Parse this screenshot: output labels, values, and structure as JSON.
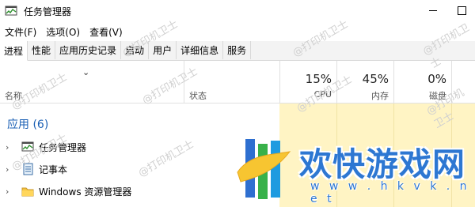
{
  "window": {
    "title": "任务管理器"
  },
  "menu": {
    "file": "文件(F)",
    "options": "选项(O)",
    "view": "查看(V)"
  },
  "tabs": [
    {
      "label": "进程",
      "active": true
    },
    {
      "label": "性能"
    },
    {
      "label": "应用历史记录"
    },
    {
      "label": "启动"
    },
    {
      "label": "用户"
    },
    {
      "label": "详细信息"
    },
    {
      "label": "服务"
    }
  ],
  "columns": {
    "name": "名称",
    "status": "状态",
    "cpu": {
      "pct": "15%",
      "label": "CPU"
    },
    "memory": {
      "pct": "45%",
      "label": "内存"
    },
    "disk": {
      "pct": "0%",
      "label": "磁盘"
    }
  },
  "group": {
    "label": "应用 (6)"
  },
  "rows": [
    {
      "label": "任务管理器",
      "icon": "task-manager-icon"
    },
    {
      "label": "记事本",
      "icon": "notepad-icon"
    },
    {
      "label": "Windows 资源管理器",
      "icon": "folder-icon"
    }
  ],
  "watermark": {
    "text": "@打印机卫士"
  },
  "overlay_logo": {
    "title": "欢快游戏网",
    "url": "w w w . h k v k . n e t"
  },
  "colors": {
    "accent": "#1a5fb4",
    "heat": "#fff4c4",
    "logo": "#2d77d2"
  }
}
